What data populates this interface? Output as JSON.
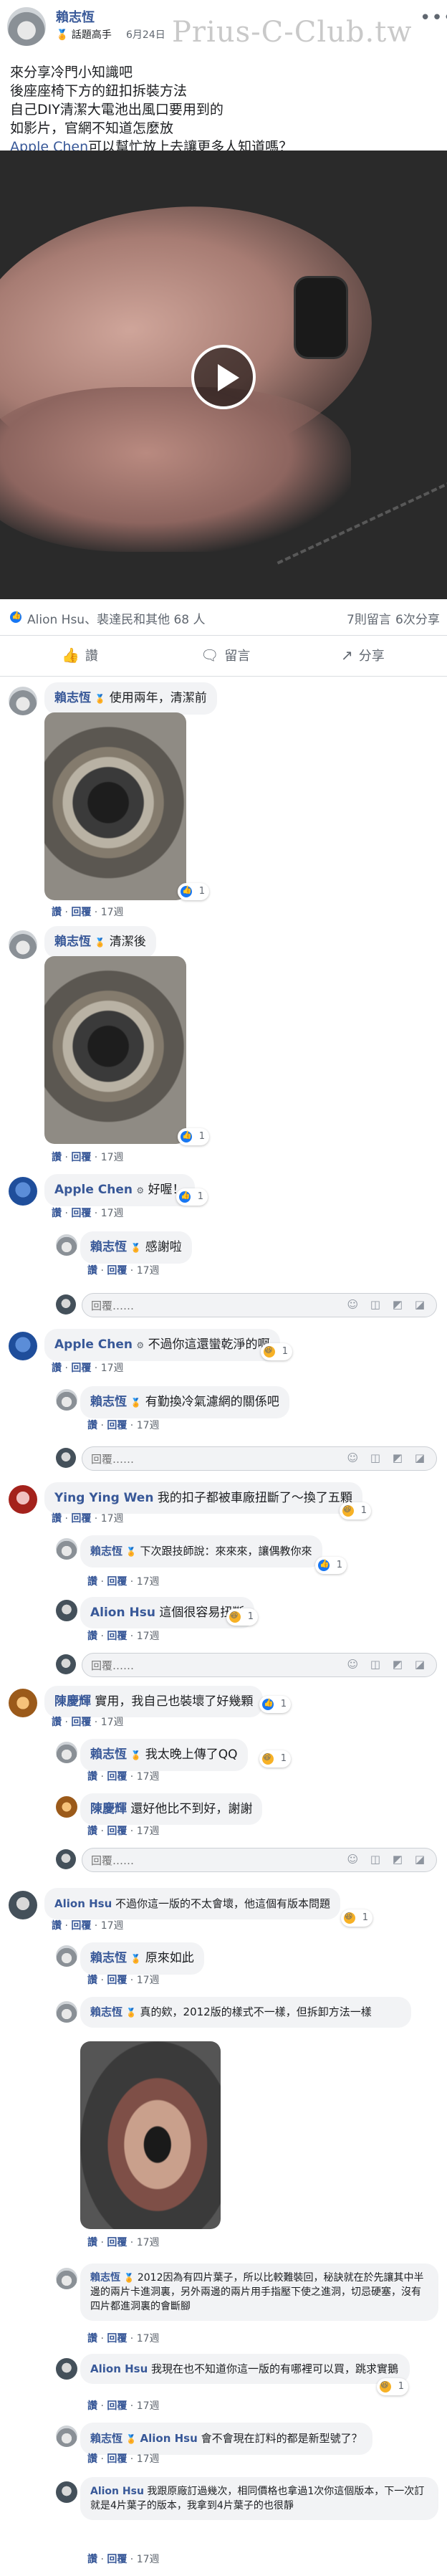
{
  "post": {
    "author": "賴志恆",
    "badge": "話題高手",
    "date": "6月24日",
    "watermark": "Prius-C-Club.tw",
    "more": "•••",
    "lines": [
      "來分享冷門小知識吧",
      "後座座椅下方的鈕扣拆裝方法",
      "自己DIY清潔大電池出風口要用到的",
      "如影片，官網不知道怎麼放"
    ],
    "last_line_mention": "Apple Chen",
    "last_line_rest": "可以幫忙放上去讓更多人知道嗎？"
  },
  "stats": {
    "reactors": "Alion Hsu、裴達民和其他 68 人",
    "comments": "7則留言",
    "shares": "6次分享"
  },
  "actions": {
    "like": "讚",
    "comment": "留言",
    "share": "分享"
  },
  "reply_placeholder": "回覆……",
  "comments": [
    {
      "author": "賴志恆",
      "text": "使用兩年，清潔前",
      "like": "讚",
      "reply": "回覆",
      "time": "17週",
      "reactions": "1"
    },
    {
      "author": "賴志恆",
      "text": "清潔後",
      "like": "讚",
      "reply": "回覆",
      "time": "17週",
      "reactions": "1"
    },
    {
      "author": "Apple Chen",
      "text": "好喔！",
      "like": "讚",
      "reply": "回覆",
      "time": "17週",
      "reactions": "1"
    },
    {
      "author": "賴志恆",
      "text": "感謝啦",
      "like": "讚",
      "reply": "回覆",
      "time": "17週"
    },
    {
      "author": "Apple Chen",
      "text": "不過你這還蠻乾淨的啊",
      "like": "讚",
      "reply": "回覆",
      "time": "17週",
      "reactions": "1"
    },
    {
      "author": "賴志恆",
      "text": "有勤換冷氣濾網的關係吧",
      "like": "讚",
      "reply": "回覆",
      "time": "17週"
    },
    {
      "author": "Ying Ying Wen",
      "text": "我的扣子都被車廠扭斷了～換了五顆",
      "like": "讚",
      "reply": "回覆",
      "time": "17週",
      "reactions": "1"
    },
    {
      "author": "賴志恆",
      "text": "下次跟技師說：來來來，讓偶教你來",
      "like": "讚",
      "reply": "回覆",
      "time": "17週",
      "reactions": "1"
    },
    {
      "author": "Alion Hsu",
      "text": "這個很容易扭斷",
      "like": "讚",
      "reply": "回覆",
      "time": "17週",
      "reactions": "1"
    },
    {
      "author": "陳慶輝",
      "text": "實用，我自己也裝壞了好幾顆",
      "like": "讚",
      "reply": "回覆",
      "time": "17週",
      "reactions": "1"
    },
    {
      "author": "賴志恆",
      "text": "我太晚上傳了QQ",
      "like": "讚",
      "reply": "回覆",
      "time": "17週",
      "reactions": "1"
    },
    {
      "author": "陳慶輝",
      "text": "還好他比不到好，謝謝",
      "like": "讚",
      "reply": "回覆",
      "time": "17週"
    },
    {
      "author": "Alion Hsu",
      "text": "不過你這一版的不太會壞，他這個有版本問題",
      "like": "讚",
      "reply": "回覆",
      "time": "17週",
      "reactions": "1"
    },
    {
      "author": "賴志恆",
      "text": "原來如此",
      "like": "讚",
      "reply": "回覆",
      "time": "17週"
    },
    {
      "author": "賴志恆",
      "text": "真的欸，2012版的樣式不一樣，但拆卸方法一樣",
      "like": "讚",
      "reply": "回覆",
      "time": "17週"
    },
    {
      "author": "賴志恆",
      "text": "2012因為有四片葉子，所以比較難裝回，秘訣就在於先讓其中半邊的兩片卡進洞裏，另外兩邊的兩片用手指壓下使之進洞，切忌硬塞，沒有四片都進洞裏的會斷腳",
      "like": "讚",
      "reply": "回覆",
      "time": "17週"
    },
    {
      "author": "Alion Hsu",
      "text": "我現在也不知道你這一版的有哪裡可以買，跳求實鵝",
      "like": "讚",
      "reply": "回覆",
      "time": "17週",
      "reactions": "1"
    },
    {
      "author": "賴志恆",
      "mention": "Alion Hsu",
      "text": "會不會現在訂料的都是新型號了？",
      "like": "讚",
      "reply": "回覆",
      "time": "17週"
    },
    {
      "author": "Alion Hsu",
      "text": "我跟原廠訂過幾次，相同價格也拿過1次你這個版本，下一次訂就是4片葉子的版本，我拿到4片葉子的也很靜",
      "like": "讚",
      "reply": "回覆",
      "time": "17週"
    }
  ]
}
